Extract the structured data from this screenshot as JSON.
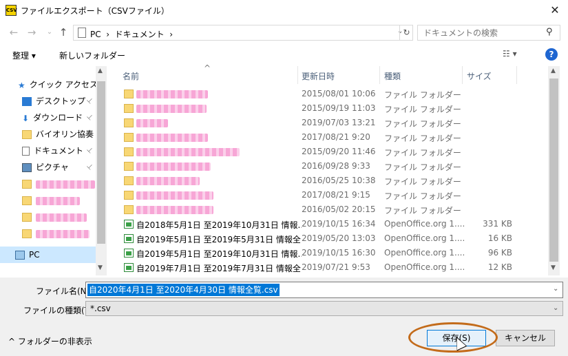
{
  "window": {
    "title": "ファイルエクスポート（CSVファイル）",
    "app_icon": "app-icon",
    "close": "✕"
  },
  "nav": {
    "back": "←",
    "forward": "→",
    "recent": "⌄",
    "up": "↑",
    "address": "PC  ›  ドキュメント  ›",
    "refresh": "↻",
    "search_placeholder": "ドキュメントの検索"
  },
  "commands": {
    "organize": "整理 ▾",
    "new_folder": "新しいフォルダー",
    "view": "☷ ▾",
    "help": "?"
  },
  "sidebar": {
    "items": [
      {
        "label": "クイック アクセス",
        "icon": "star-icon"
      },
      {
        "label": "デスクトップ",
        "icon": "desktop-icon",
        "pinned": true
      },
      {
        "label": "ダウンロード",
        "icon": "download-icon",
        "pinned": true
      },
      {
        "label": "バイオリン協奏",
        "icon": "folder-icon",
        "pinned": true
      },
      {
        "label": "ドキュメント",
        "icon": "document-icon",
        "pinned": true
      },
      {
        "label": "ピクチャ",
        "icon": "pictures-icon",
        "pinned": true
      },
      {
        "label": "",
        "icon": "folder-icon",
        "redacted": true
      },
      {
        "label": "",
        "icon": "folder-icon",
        "redacted": true
      },
      {
        "label": "",
        "icon": "folder-icon",
        "redacted": true
      },
      {
        "label": "",
        "icon": "folder-icon",
        "redacted": true
      },
      {
        "label": "PC",
        "icon": "pc-icon",
        "selected": true
      }
    ],
    "pin_glyph": "📌"
  },
  "columns": {
    "name": "名前",
    "date": "更新日時",
    "type": "種類",
    "size": "サイズ",
    "sort_glyph": "^"
  },
  "files": [
    {
      "name": "",
      "date": "2015/08/01 10:06",
      "type": "ファイル フォルダー",
      "size": "",
      "kind": "folder"
    },
    {
      "name": "",
      "date": "2015/09/19 11:03",
      "type": "ファイル フォルダー",
      "size": "",
      "kind": "folder"
    },
    {
      "name": "",
      "date": "2019/07/03 13:21",
      "type": "ファイル フォルダー",
      "size": "",
      "kind": "folder"
    },
    {
      "name": "",
      "date": "2017/08/21 9:20",
      "type": "ファイル フォルダー",
      "size": "",
      "kind": "folder"
    },
    {
      "name": "",
      "date": "2015/09/20 11:46",
      "type": "ファイル フォルダー",
      "size": "",
      "kind": "folder"
    },
    {
      "name": "",
      "date": "2016/09/28 9:33",
      "type": "ファイル フォルダー",
      "size": "",
      "kind": "folder"
    },
    {
      "name": "",
      "date": "2016/05/25 10:38",
      "type": "ファイル フォルダー",
      "size": "",
      "kind": "folder"
    },
    {
      "name": "",
      "date": "2017/08/21 9:15",
      "type": "ファイル フォルダー",
      "size": "",
      "kind": "folder"
    },
    {
      "name": "",
      "date": "2016/05/02 20:15",
      "type": "ファイル フォルダー",
      "size": "",
      "kind": "folder"
    },
    {
      "name": "自2018年5月1日 至2019年10月31日 情報...",
      "date": "2019/10/15 16:34",
      "type": "OpenOffice.org 1....",
      "size": "331 KB",
      "kind": "sheet"
    },
    {
      "name": "自2019年5月1日 至2019年5月31日 情報全...",
      "date": "2019/05/20 13:03",
      "type": "OpenOffice.org 1....",
      "size": "16 KB",
      "kind": "sheet"
    },
    {
      "name": "自2019年5月1日 至2019年10月31日 情報...",
      "date": "2019/10/15 16:30",
      "type": "OpenOffice.org 1....",
      "size": "96 KB",
      "kind": "sheet"
    },
    {
      "name": "自2019年7月1日 至2019年7月31日 情報全...",
      "date": "2019/07/21 9:53",
      "type": "OpenOffice.org 1....",
      "size": "12 KB",
      "kind": "sheet"
    }
  ],
  "form": {
    "filename_label": "ファイル名(N):",
    "filename_value": "自2020年4月1日 至2020年4月30日 情報全覧.csv",
    "filetype_label": "ファイルの種類(T):",
    "filetype_value": "*.csv",
    "hide_folders": "^  フォルダーの非表示",
    "save": "保存(S)",
    "cancel": "キャンセル"
  },
  "colors": {
    "accent": "#0078d7",
    "selection": "#cce8ff",
    "annotation": "#c36b1a",
    "redaction": "#f7a6d6"
  }
}
